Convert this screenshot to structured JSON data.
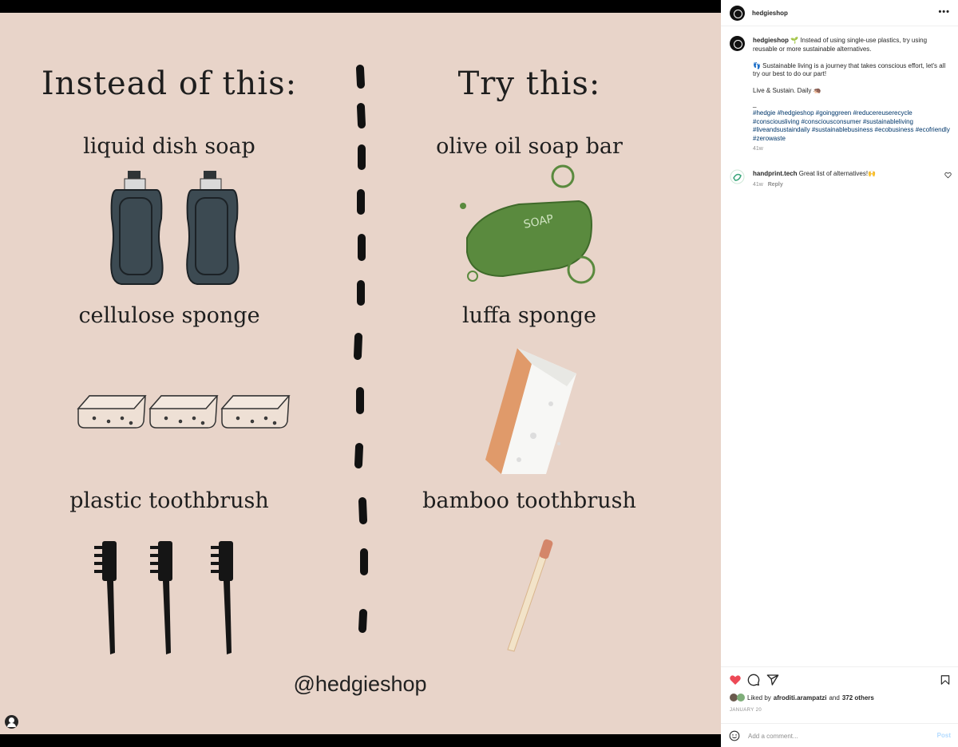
{
  "image": {
    "left_title": "Instead of this:",
    "right_title": "Try this:",
    "items_left": [
      "liquid dish soap",
      "cellulose sponge",
      "plastic toothbrush"
    ],
    "items_right": [
      "olive oil soap bar",
      "luffa sponge",
      "bamboo toothbrush"
    ],
    "soap_text": "SOAP",
    "handle": "@hedgieshop"
  },
  "header": {
    "username": "hedgieshop",
    "more": "•••"
  },
  "caption": {
    "username": "hedgieshop",
    "line1": "🌱 Instead of using single-use plastics, try using reusable or more sustainable alternatives.",
    "line2": "👣 Sustainable living is a journey that takes conscious effort, let's all try our best to do our part!",
    "line3": "Live & Sustain. Daily 🦔",
    "dot": "_",
    "hashtags": "#hedgie #hedgieshop #goinggreen #reducereuserecycle #consciousliving #consciousconsumer #sustainableliving #liveandsustaindaily #sustainablebusiness #ecobusiness #ecofriendly #zerowaste",
    "time": "41w"
  },
  "comment": {
    "username": "handprint.tech",
    "text": "Great list of alternatives!🙌",
    "time": "41w",
    "reply": "Reply"
  },
  "likes": {
    "prefix": "Liked by",
    "user": "afroditi.arampatzi",
    "and": "and",
    "others": "372 others"
  },
  "date": "JANUARY 20",
  "add_comment": {
    "placeholder": "Add a comment...",
    "post": "Post"
  },
  "colors": {
    "bg": "#e8d4c9",
    "heart": "#ed4956",
    "link": "#00376b",
    "post_btn": "#b3dbff"
  }
}
